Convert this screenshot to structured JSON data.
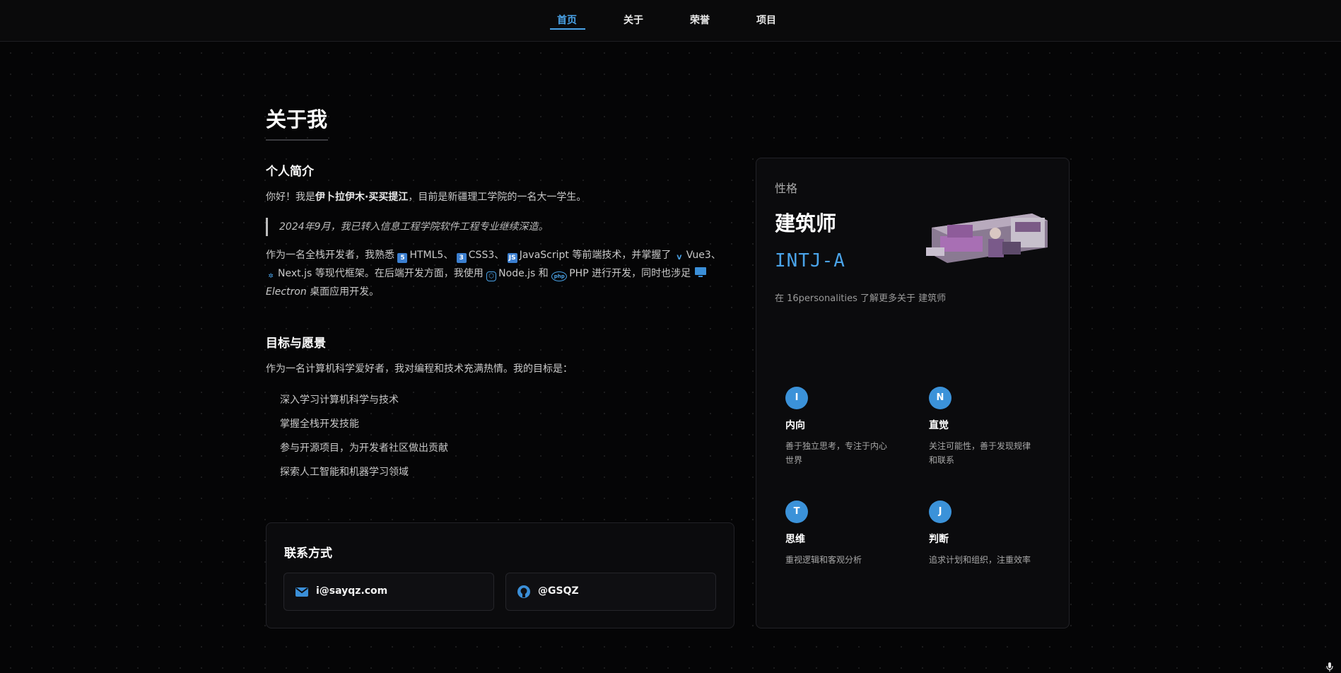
{
  "nav": {
    "items": [
      {
        "label": "首页",
        "active": true
      },
      {
        "label": "关于",
        "active": false
      },
      {
        "label": "荣誉",
        "active": false
      },
      {
        "label": "项目",
        "active": false
      }
    ]
  },
  "about": {
    "title": "关于我",
    "intro_heading": "个人简介",
    "intro_pre": "你好！我是",
    "intro_name": "伊卜拉伊木·买买提江",
    "intro_post": "，目前是新疆理工学院的一名大一学生。",
    "quote": "2024年9月，我已转入信息工程学院软件工程专业继续深造。",
    "tech_pre": "作为一名全栈开发者，我熟悉",
    "tech_html": "HTML5",
    "tech_sep1": "、",
    "tech_css": "CSS3",
    "tech_sep2": "、",
    "tech_js": "JavaScript",
    "tech_mid1": "等前端技术，并掌握了",
    "tech_vue": "Vue3",
    "tech_sep3": "、",
    "tech_next": "Next.js",
    "tech_mid2": "等现代框架。在后端开发方面，我使用",
    "tech_node": "Node.js",
    "tech_and": "和",
    "tech_php": "PHP",
    "tech_mid3": "进行开发，同时也涉足",
    "tech_electron": "Electron",
    "tech_end": "桌面应用开发。",
    "goals_heading": "目标与愿景",
    "goals_intro": "作为一名计算机科学爱好者，我对编程和技术充满热情。我的目标是：",
    "goals": [
      "深入学习计算机科学与技术",
      "掌握全栈开发技能",
      "参与开源项目，为开发者社区做出贡献",
      "探索人工智能和机器学习领域"
    ]
  },
  "contact": {
    "title": "联系方式",
    "email": "i@sayqz.com",
    "github": "@GSQZ"
  },
  "personality": {
    "label": "性格",
    "name": "建筑师",
    "code": "INTJ-A",
    "link_text": "在 16personalities 了解更多关于 建筑师",
    "traits": [
      {
        "letter": "I",
        "title": "内向",
        "desc": "善于独立思考，专注于内心世界"
      },
      {
        "letter": "N",
        "title": "直觉",
        "desc": "关注可能性，善于发现规律和联系"
      },
      {
        "letter": "T",
        "title": "思维",
        "desc": "重视逻辑和客观分析"
      },
      {
        "letter": "J",
        "title": "判断",
        "desc": "追求计划和组织，注重效率"
      }
    ]
  },
  "colors": {
    "accent": "#4aa3e8",
    "background": "#050506"
  },
  "icons": [
    "html5-icon",
    "css3-icon",
    "javascript-icon",
    "vue-icon",
    "react-icon",
    "nodejs-icon",
    "php-icon",
    "monitor-icon",
    "mail-icon",
    "github-icon",
    "microphone-icon"
  ]
}
